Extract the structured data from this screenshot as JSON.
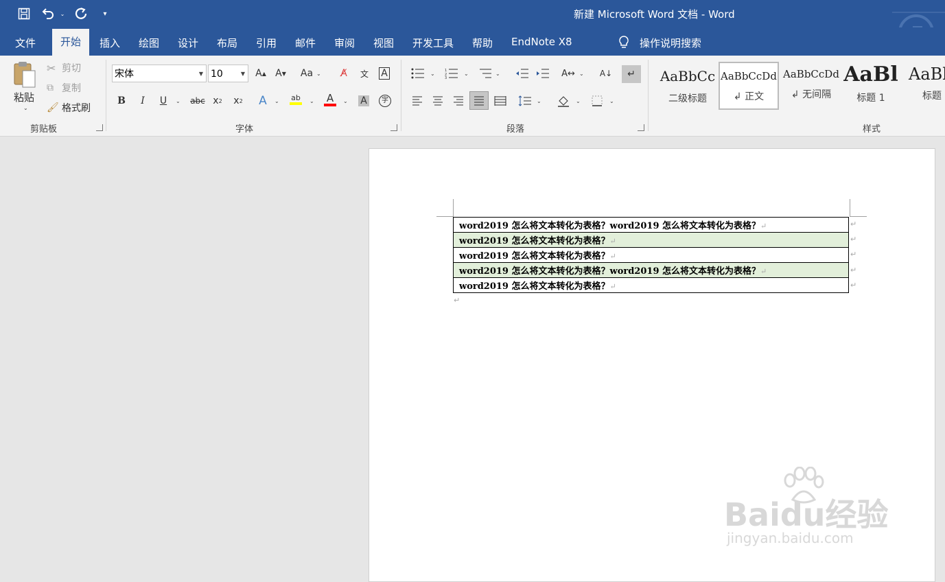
{
  "window": {
    "title": "新建 Microsoft Word 文档  -  Word"
  },
  "tabs": [
    "文件",
    "开始",
    "插入",
    "绘图",
    "设计",
    "布局",
    "引用",
    "邮件",
    "审阅",
    "视图",
    "开发工具",
    "帮助",
    "EndNote X8"
  ],
  "active_tab": "开始",
  "tell_me": "操作说明搜索",
  "clipboard": {
    "paste": "粘贴",
    "cut": "剪切",
    "copy": "复制",
    "format_painter": "格式刷",
    "group": "剪贴板"
  },
  "font": {
    "name": "宋体",
    "size": "10",
    "group": "字体",
    "case_label": "Aa",
    "strike_label": "abc"
  },
  "paragraph": {
    "group": "段落"
  },
  "styles": {
    "group": "样式",
    "items": [
      {
        "sample": "AaBbCc",
        "label": "二级标题"
      },
      {
        "sample": "AaBbCcDd",
        "label": "↲ 正文"
      },
      {
        "sample": "AaBbCcDd",
        "label": "↲ 无间隔"
      },
      {
        "sample": "AaBl",
        "label": "标题 1"
      },
      {
        "sample": "AaBb",
        "label": "标题"
      }
    ]
  },
  "document": {
    "rows": [
      "word2019 怎么将文本转化为表格？word2019 怎么将文本转化为表格？",
      "word2019 怎么将文本转化为表格？",
      "word2019 怎么将文本转化为表格？",
      "word2019 怎么将文本转化为表格？word2019 怎么将文本转化为表格？",
      "word2019 怎么将文本转化为表格？"
    ],
    "paragraph_mark": "↵"
  },
  "watermark": {
    "brand": "Baidu经验",
    "url": "jingyan.baidu.com"
  },
  "colors": {
    "titlebar": "#2b579a",
    "ribbon": "#f3f3f3",
    "row_alt": "#e2efda",
    "highlight": "#ffff00",
    "font_color": "#ff0000"
  }
}
